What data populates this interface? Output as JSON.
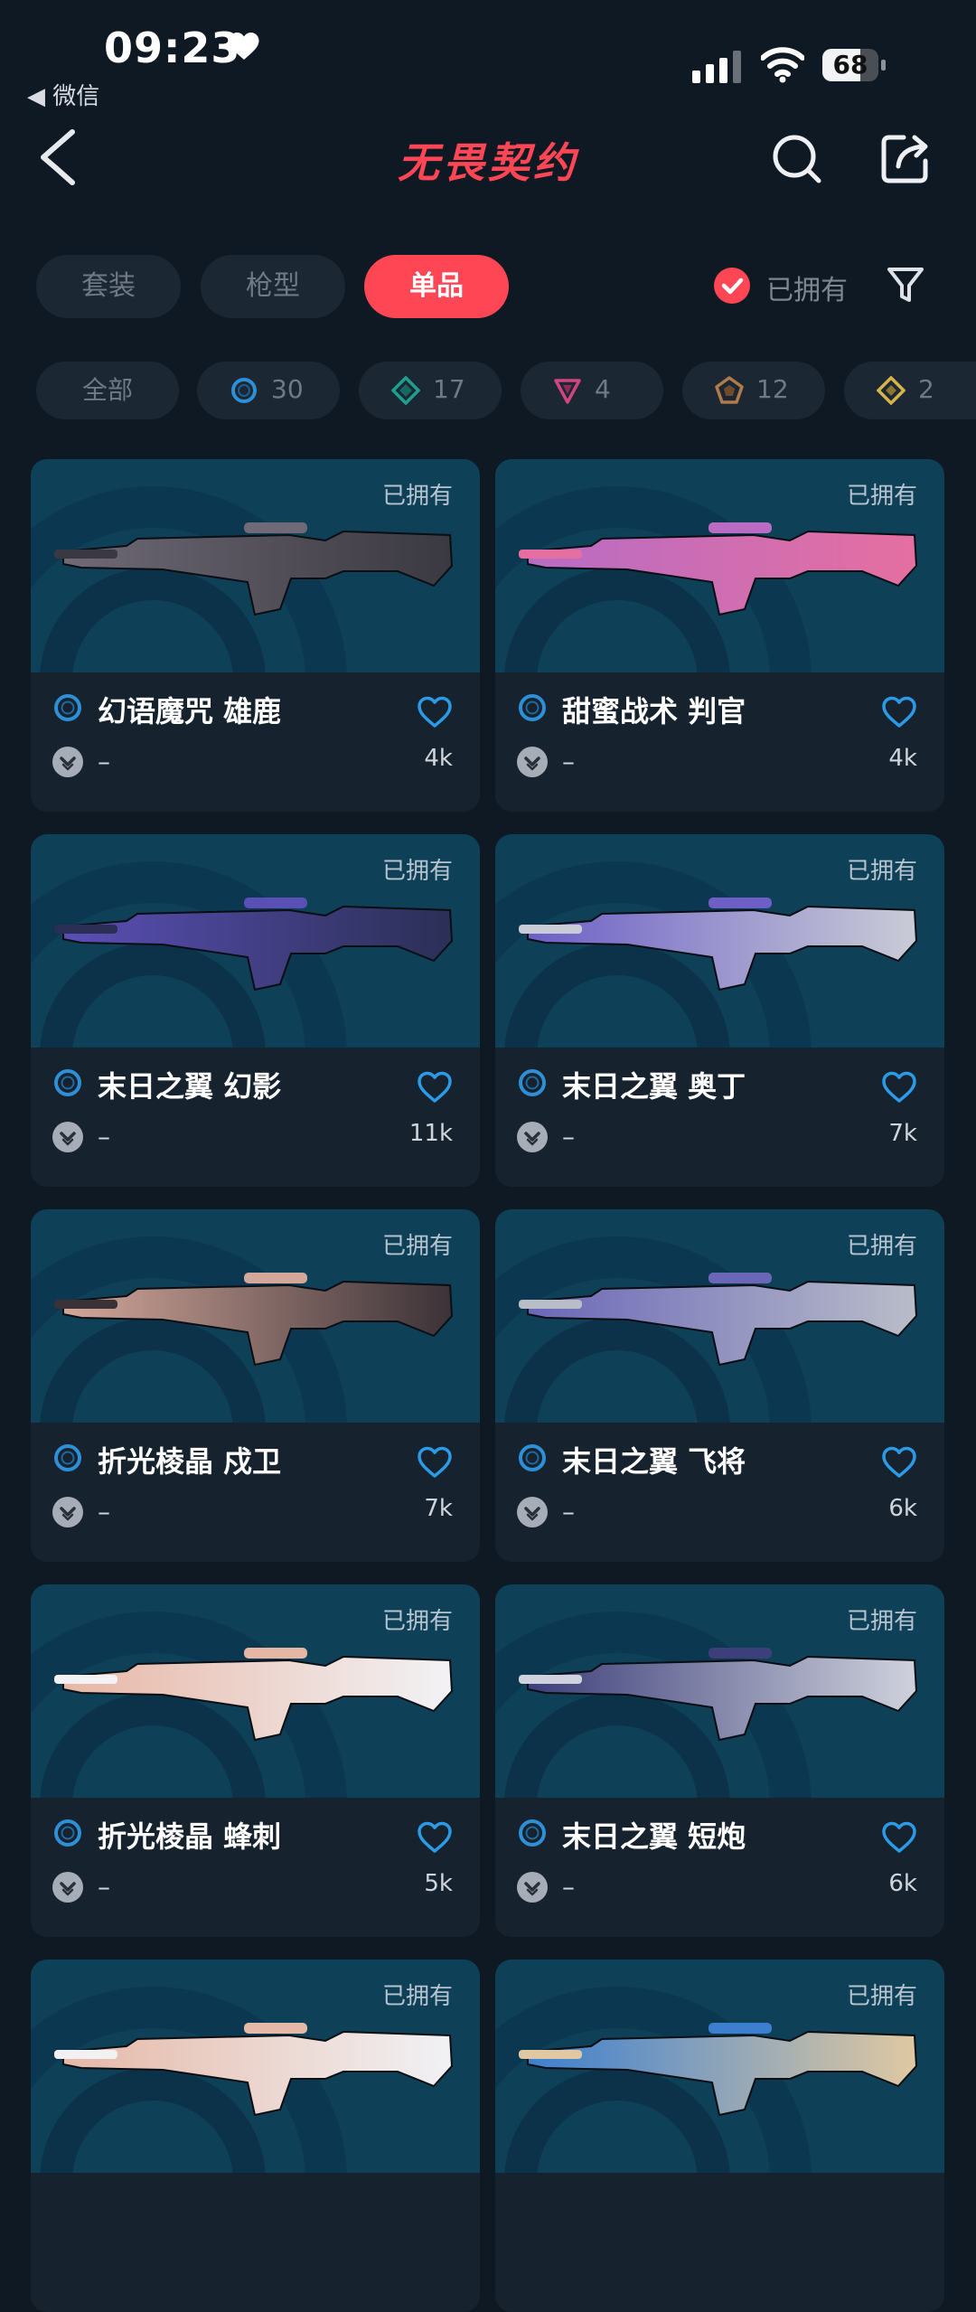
{
  "status": {
    "time": "09:23",
    "back_app": "◀ 微信",
    "battery": "68",
    "battery_level": 0.68
  },
  "nav": {
    "title": "无畏契约"
  },
  "tabs": [
    {
      "label": "套装",
      "active": false
    },
    {
      "label": "枪型",
      "active": false
    },
    {
      "label": "单品",
      "active": true
    }
  ],
  "owned_filter": {
    "label": "已拥有",
    "checked": true
  },
  "rarity_chips": [
    {
      "label": "全部"
    },
    {
      "count": "30",
      "icon": "select-tier-icon",
      "color": "#2e8fd6"
    },
    {
      "count": "17",
      "icon": "deluxe-tier-icon",
      "color": "#1f9f8f"
    },
    {
      "count": "4",
      "icon": "exclusive-tier-icon",
      "color": "#d0457f"
    },
    {
      "count": "12",
      "icon": "premium-tier-icon",
      "color": "#b07a4a"
    },
    {
      "count": "2",
      "icon": "ultra-tier-icon",
      "color": "#d6b44a"
    }
  ],
  "items": [
    {
      "owned": "已拥有",
      "name": "幻语魔咒 雄鹿",
      "sub": "–",
      "likes": "4k",
      "palette": [
        "#6f6a76",
        "#3a3840"
      ]
    },
    {
      "owned": "已拥有",
      "name": "甜蜜战术 判官",
      "sub": "–",
      "likes": "4k",
      "palette": [
        "#b86cc4",
        "#e56fa0"
      ]
    },
    {
      "owned": "已拥有",
      "name": "末日之翼 幻影",
      "sub": "–",
      "likes": "11k",
      "palette": [
        "#5a4fb5",
        "#2b2f55"
      ]
    },
    {
      "owned": "已拥有",
      "name": "末日之翼 奥丁",
      "sub": "–",
      "likes": "7k",
      "palette": [
        "#6d5fc6",
        "#c9ccd6"
      ]
    },
    {
      "owned": "已拥有",
      "name": "折光棱晶 戍卫",
      "sub": "–",
      "likes": "7k",
      "palette": [
        "#d3a79a",
        "#3b3237"
      ]
    },
    {
      "owned": "已拥有",
      "name": "末日之翼 飞将",
      "sub": "–",
      "likes": "6k",
      "palette": [
        "#6b67b8",
        "#b9bdc8"
      ]
    },
    {
      "owned": "已拥有",
      "name": "折光棱晶 蜂刺",
      "sub": "–",
      "likes": "5k",
      "palette": [
        "#e7b7a6",
        "#f2f2f5"
      ]
    },
    {
      "owned": "已拥有",
      "name": "末日之翼 短炮",
      "sub": "–",
      "likes": "6k",
      "palette": [
        "#3d3f7a",
        "#cfd2dc"
      ]
    },
    {
      "owned": "已拥有",
      "name": "",
      "sub": "",
      "likes": "",
      "palette": [
        "#e5b9a8",
        "#f1f1f4"
      ]
    },
    {
      "owned": "已拥有",
      "name": "",
      "sub": "",
      "likes": "",
      "palette": [
        "#3c7fcf",
        "#e0c9a2"
      ]
    }
  ]
}
